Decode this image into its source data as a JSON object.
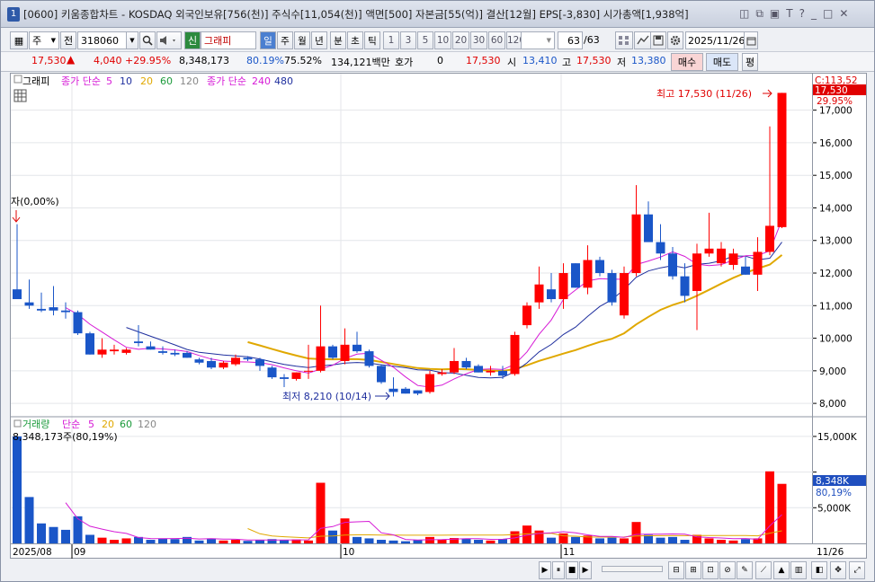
{
  "window": {
    "badge": "1",
    "title": "[0600] 키움종합차트 - KOSDAQ 외국인보유[756(천)] 주식수[11,054(천)] 액면[500] 자본금[55(억)] 결산[12월] EPS[-3,830] 시가총액[1,938억]",
    "icons": [
      "◫",
      "⧉",
      "▣",
      "T",
      "?",
      "_",
      "□",
      "✕"
    ]
  },
  "toolbar": {
    "menu_icon": "▦",
    "period": "주",
    "prev_label": "전",
    "code": "318060",
    "sin_label": "신",
    "stock_name": "그래피",
    "period_buttons": [
      "일",
      "주",
      "월",
      "년",
      "분",
      "초",
      "틱"
    ],
    "active_period": "일",
    "minute_buttons": [
      "1",
      "3",
      "5",
      "10",
      "20",
      "30",
      "60",
      "120"
    ],
    "count": "63",
    "count_total": "/63",
    "date": "2025/11/26"
  },
  "quote": {
    "price": "17,530",
    "change": "4,040",
    "change_pct": "+29.95%",
    "volume": "8,348,173",
    "ratio1": "80.19%",
    "ratio2": "75.52%",
    "amount": "134,121백만",
    "hoga_label": "호가",
    "hoga_value": "0",
    "hoga_price": "17,530",
    "open_label": "시",
    "open": "13,410",
    "high_label": "고",
    "high": "17,530",
    "low_label": "저",
    "low": "13,380",
    "buy_label": "매수",
    "sell_label": "매도",
    "eval_label": "평"
  },
  "legend": {
    "stock_label": "그래피",
    "ma1_label": "종가 단순",
    "ma1_periods": [
      "5",
      "10",
      "20",
      "60",
      "120"
    ],
    "ma2_label": "종가 단순",
    "ma2_periods": [
      "240",
      "480"
    ],
    "vol_label": "거래량",
    "vol_ma_label": "단순",
    "vol_periods": [
      "5",
      "20",
      "60",
      "120"
    ],
    "vol_current": "8,348,173주(80,19%)"
  },
  "colors": {
    "up": "#ff0000",
    "down": "#1a56c8",
    "ma5": "#d61ad6",
    "ma10": "#1f2f9e",
    "ma20": "#e0a800",
    "ma60": "#1a9a3a"
  },
  "annotations": {
    "high_label": "최고 17,530 (11/26)",
    "low_label": "최저 8,210 (10/14)",
    "start_label": "자(0,00%)"
  },
  "price_axis": {
    "ticks": [
      "17,000",
      "16,000",
      "15,000",
      "14,000",
      "13,000",
      "12,000",
      "11,000",
      "10,000",
      "9,000",
      "8,000"
    ],
    "current_top": "C:113,52",
    "current_price": "17,530",
    "current_pct": "29.95%"
  },
  "volume_axis": {
    "ticks": [
      "15,000K",
      "10,000K",
      "5,000K"
    ],
    "current": "8,348K",
    "current_pct": "80,19%"
  },
  "date_axis": [
    "2025/08",
    "09",
    "10",
    "11",
    "11/26"
  ],
  "chart_data": {
    "type": "candlestick",
    "title": "그래피",
    "ylim": [
      7700,
      17900
    ],
    "volume_ylim": [
      0,
      16500
    ],
    "candles": [
      {
        "o": 11500,
        "h": 13500,
        "l": 11200,
        "c": 11200,
        "v": 15000
      },
      {
        "o": 11100,
        "h": 11800,
        "l": 10900,
        "c": 11000,
        "v": 6500
      },
      {
        "o": 10900,
        "h": 11400,
        "l": 10800,
        "c": 10850,
        "v": 2800
      },
      {
        "o": 10950,
        "h": 11600,
        "l": 10700,
        "c": 10850,
        "v": 2300
      },
      {
        "o": 10850,
        "h": 11100,
        "l": 10600,
        "c": 10800,
        "v": 1900
      },
      {
        "o": 10800,
        "h": 10850,
        "l": 10100,
        "c": 10150,
        "v": 3800
      },
      {
        "o": 10150,
        "h": 10200,
        "l": 9500,
        "c": 9500,
        "v": 1200
      },
      {
        "o": 9500,
        "h": 10000,
        "l": 9400,
        "c": 9650,
        "v": 800
      },
      {
        "o": 9600,
        "h": 9800,
        "l": 9500,
        "c": 9650,
        "v": 500
      },
      {
        "o": 9550,
        "h": 9700,
        "l": 9500,
        "c": 9650,
        "v": 700
      },
      {
        "o": 9900,
        "h": 10400,
        "l": 9750,
        "c": 9850,
        "v": 900
      },
      {
        "o": 9750,
        "h": 9900,
        "l": 9650,
        "c": 9650,
        "v": 500
      },
      {
        "o": 9600,
        "h": 9750,
        "l": 9500,
        "c": 9550,
        "v": 700
      },
      {
        "o": 9550,
        "h": 9650,
        "l": 9450,
        "c": 9500,
        "v": 600
      },
      {
        "o": 9550,
        "h": 9600,
        "l": 9400,
        "c": 9400,
        "v": 900
      },
      {
        "o": 9350,
        "h": 9400,
        "l": 9200,
        "c": 9250,
        "v": 400
      },
      {
        "o": 9300,
        "h": 9400,
        "l": 9050,
        "c": 9100,
        "v": 700
      },
      {
        "o": 9100,
        "h": 9300,
        "l": 9050,
        "c": 9250,
        "v": 400
      },
      {
        "o": 9200,
        "h": 9500,
        "l": 9150,
        "c": 9400,
        "v": 500
      },
      {
        "o": 9400,
        "h": 9450,
        "l": 9300,
        "c": 9350,
        "v": 350
      },
      {
        "o": 9350,
        "h": 9400,
        "l": 9000,
        "c": 9150,
        "v": 450
      },
      {
        "o": 9100,
        "h": 9150,
        "l": 8750,
        "c": 8800,
        "v": 600
      },
      {
        "o": 8800,
        "h": 8900,
        "l": 8500,
        "c": 8750,
        "v": 500
      },
      {
        "o": 8750,
        "h": 8950,
        "l": 8700,
        "c": 8950,
        "v": 550
      },
      {
        "o": 9000,
        "h": 9800,
        "l": 8750,
        "c": 9000,
        "v": 400
      },
      {
        "o": 9000,
        "h": 11000,
        "l": 8950,
        "c": 9750,
        "v": 8500
      },
      {
        "o": 9750,
        "h": 9800,
        "l": 9350,
        "c": 9400,
        "v": 1800
      },
      {
        "o": 9300,
        "h": 10300,
        "l": 9200,
        "c": 9800,
        "v": 3500
      },
      {
        "o": 9800,
        "h": 10200,
        "l": 9550,
        "c": 9600,
        "v": 900
      },
      {
        "o": 9600,
        "h": 9650,
        "l": 9100,
        "c": 9150,
        "v": 700
      },
      {
        "o": 9150,
        "h": 9200,
        "l": 8600,
        "c": 8650,
        "v": 500
      },
      {
        "o": 8450,
        "h": 8800,
        "l": 8210,
        "c": 8350,
        "v": 400
      },
      {
        "o": 8450,
        "h": 8500,
        "l": 8300,
        "c": 8300,
        "v": 300
      },
      {
        "o": 8400,
        "h": 8400,
        "l": 8250,
        "c": 8300,
        "v": 500
      },
      {
        "o": 8350,
        "h": 9000,
        "l": 8300,
        "c": 8900,
        "v": 900
      },
      {
        "o": 8900,
        "h": 9050,
        "l": 8850,
        "c": 8950,
        "v": 550
      },
      {
        "o": 8950,
        "h": 9700,
        "l": 8900,
        "c": 9300,
        "v": 750
      },
      {
        "o": 9300,
        "h": 9400,
        "l": 9050,
        "c": 9100,
        "v": 650
      },
      {
        "o": 9150,
        "h": 9200,
        "l": 8950,
        "c": 8950,
        "v": 500
      },
      {
        "o": 8950,
        "h": 9150,
        "l": 8850,
        "c": 9000,
        "v": 400
      },
      {
        "o": 9000,
        "h": 9150,
        "l": 8750,
        "c": 8850,
        "v": 600
      },
      {
        "o": 8900,
        "h": 10200,
        "l": 8850,
        "c": 10100,
        "v": 1700
      },
      {
        "o": 10400,
        "h": 11100,
        "l": 10300,
        "c": 11000,
        "v": 2500
      },
      {
        "o": 11100,
        "h": 12200,
        "l": 10900,
        "c": 11650,
        "v": 1800
      },
      {
        "o": 11500,
        "h": 12000,
        "l": 11100,
        "c": 11200,
        "v": 800
      },
      {
        "o": 11200,
        "h": 12300,
        "l": 10900,
        "c": 12000,
        "v": 1400
      },
      {
        "o": 12300,
        "h": 12300,
        "l": 11550,
        "c": 11550,
        "v": 900
      },
      {
        "o": 11550,
        "h": 12850,
        "l": 11350,
        "c": 12400,
        "v": 1100
      },
      {
        "o": 12400,
        "h": 12500,
        "l": 11900,
        "c": 12000,
        "v": 700
      },
      {
        "o": 12000,
        "h": 12100,
        "l": 11000,
        "c": 11100,
        "v": 800
      },
      {
        "o": 10700,
        "h": 12200,
        "l": 10600,
        "c": 12000,
        "v": 700
      },
      {
        "o": 12000,
        "h": 14700,
        "l": 11900,
        "c": 13800,
        "v": 3000
      },
      {
        "o": 13800,
        "h": 14200,
        "l": 12950,
        "c": 12950,
        "v": 1200
      },
      {
        "o": 12950,
        "h": 13500,
        "l": 12400,
        "c": 12600,
        "v": 800
      },
      {
        "o": 12600,
        "h": 12800,
        "l": 11800,
        "c": 11900,
        "v": 900
      },
      {
        "o": 11900,
        "h": 12300,
        "l": 11100,
        "c": 11300,
        "v": 500
      },
      {
        "o": 11450,
        "h": 12900,
        "l": 10250,
        "c": 12600,
        "v": 1200
      },
      {
        "o": 12600,
        "h": 13850,
        "l": 12500,
        "c": 12750,
        "v": 700
      },
      {
        "o": 12300,
        "h": 12950,
        "l": 12200,
        "c": 12750,
        "v": 500
      },
      {
        "o": 12250,
        "h": 12750,
        "l": 12100,
        "c": 12600,
        "v": 400
      },
      {
        "o": 12200,
        "h": 12500,
        "l": 11950,
        "c": 11950,
        "v": 600
      },
      {
        "o": 11950,
        "h": 13100,
        "l": 11450,
        "c": 12650,
        "v": 700
      },
      {
        "o": 12650,
        "h": 16500,
        "l": 12550,
        "c": 13450,
        "v": 10100
      },
      {
        "o": 13410,
        "h": 17530,
        "l": 13380,
        "c": 17530,
        "v": 8348
      }
    ]
  }
}
